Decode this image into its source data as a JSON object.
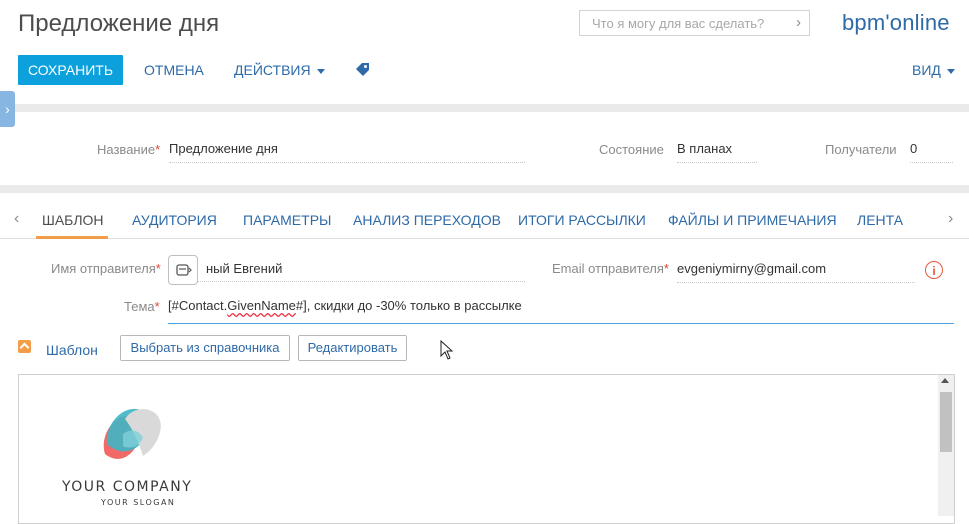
{
  "header": {
    "title": "Предложение дня",
    "search_placeholder": "Что я могу для вас сделать?",
    "logo": "bpm'online"
  },
  "toolbar": {
    "save": "СОХРАНИТЬ",
    "cancel": "ОТМЕНА",
    "actions": "ДЕЙСТВИЯ",
    "view": "ВИД"
  },
  "info": {
    "name_label": "Название",
    "name_value": "Предложение дня",
    "state_label": "Состояние",
    "state_value": "В планах",
    "recipients_label": "Получатели",
    "recipients_value": "0"
  },
  "tabs": [
    {
      "label": "ШАБЛОН"
    },
    {
      "label": "АУДИТОРИЯ"
    },
    {
      "label": "ПАРАМЕТРЫ"
    },
    {
      "label": "АНАЛИЗ ПЕРЕХОДОВ"
    },
    {
      "label": "ИТОГИ РАССЫЛКИ"
    },
    {
      "label": "ФАЙЛЫ И ПРИМЕЧАНИЯ"
    },
    {
      "label": "ЛЕНТА"
    }
  ],
  "sender": {
    "name_label": "Имя отправителя",
    "name_value": "ный Евгений",
    "email_label": "Email отправителя",
    "email_value": "evgeniymirny@gmail.com",
    "topic_label": "Тема",
    "topic_prefix": "[#Contact.",
    "topic_macro": "GivenName",
    "topic_rest": "#], скидки до -30% только в рассылке"
  },
  "template": {
    "title": "Шаблон",
    "select_button": "Выбрать из справочника",
    "edit_button": "Редактировать",
    "company_name": "YOUR COMPANY",
    "company_slogan": "YOUR SLOGAN"
  },
  "colors": {
    "accent_blue": "#0ca0dc",
    "link_blue": "#2e6aa7",
    "orange": "#f29d4a",
    "required_red": "#d9473a"
  }
}
